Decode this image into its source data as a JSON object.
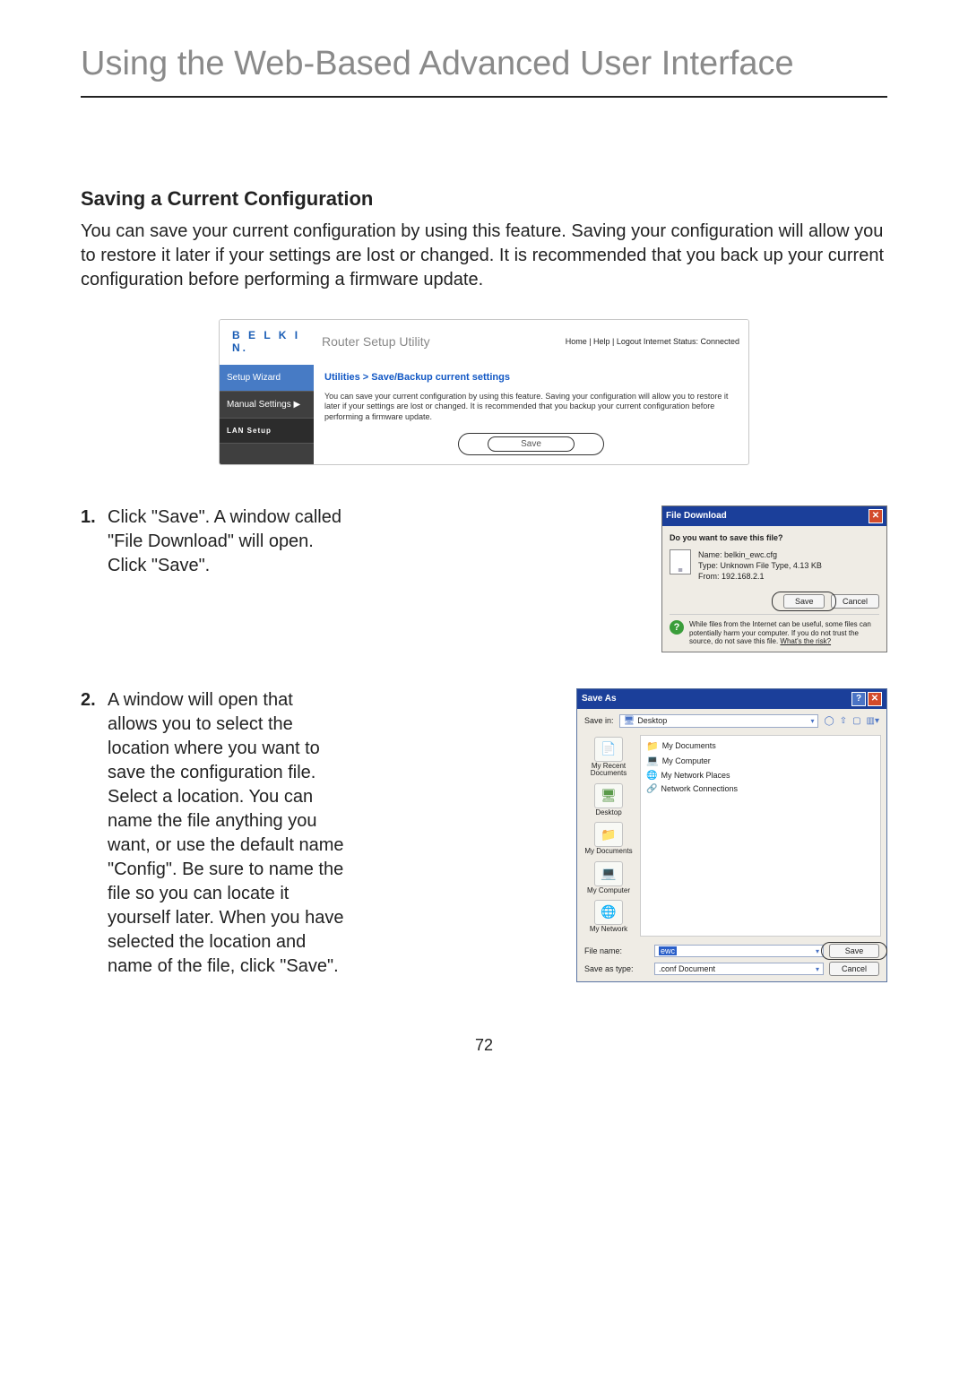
{
  "page_title": "Using the Web-Based Advanced User Interface",
  "section_heading": "Saving a Current Configuration",
  "intro_text": "You can save your current configuration by using this feature. Saving your configuration will allow you to restore it later if your settings are lost or changed. It is recommended that you back up your current configuration before performing a firmware update.",
  "router": {
    "brand": "B E L K I N.",
    "utility_title": "Router Setup Utility",
    "top_links": "Home | Help | Logout   Internet Status: Connected",
    "nav": {
      "wizard": "Setup Wizard",
      "manual": "Manual Settings ▶",
      "lan": "LAN Setup"
    },
    "breadcrumb": "Utilities > Save/Backup current settings",
    "description": "You can save your current configuration by using this feature. Saving your configuration will allow you to restore it later if your settings are lost or changed. It is recommended that you backup your current configuration before performing a firmware update.",
    "save_label": "Save"
  },
  "steps": {
    "s1_num": "1.",
    "s1_text": "Click \"Save\". A window called \"File Download\" will open. Click \"Save\".",
    "s2_num": "2.",
    "s2_text": "A window will open that allows you to select the location where you want to save the configuration file. Select a location. You can name the file anything you want, or use the default name \"Config\". Be sure to name the file so you can locate it yourself later. When you have selected the location and name of the file, click \"Save\"."
  },
  "file_download": {
    "title": "File Download",
    "question": "Do you want to save this file?",
    "name_label": "Name:",
    "name_value": "belkin_ewc.cfg",
    "type_label": "Type:",
    "type_value": "Unknown File Type, 4.13 KB",
    "from_label": "From:",
    "from_value": "192.168.2.1",
    "save_btn": "Save",
    "cancel_btn": "Cancel",
    "warning": "While files from the Internet can be useful, some files can potentially harm your computer. If you do not trust the source, do not save this file. ",
    "risk_link": "What's the risk?"
  },
  "save_as": {
    "title": "Save As",
    "savein_label": "Save in:",
    "savein_value": "Desktop",
    "places": {
      "recent": "My Recent Documents",
      "desktop": "Desktop",
      "mydocs": "My Documents",
      "mycomp": "My Computer",
      "mynet": "My Network"
    },
    "list": {
      "i0": "My Documents",
      "i1": "My Computer",
      "i2": "My Network Places",
      "i3": "Network Connections"
    },
    "filename_label": "File name:",
    "filename_value": "ewc",
    "saveastype_label": "Save as type:",
    "saveastype_value": ".conf Document",
    "save_btn": "Save",
    "cancel_btn": "Cancel"
  },
  "page_number": "72"
}
